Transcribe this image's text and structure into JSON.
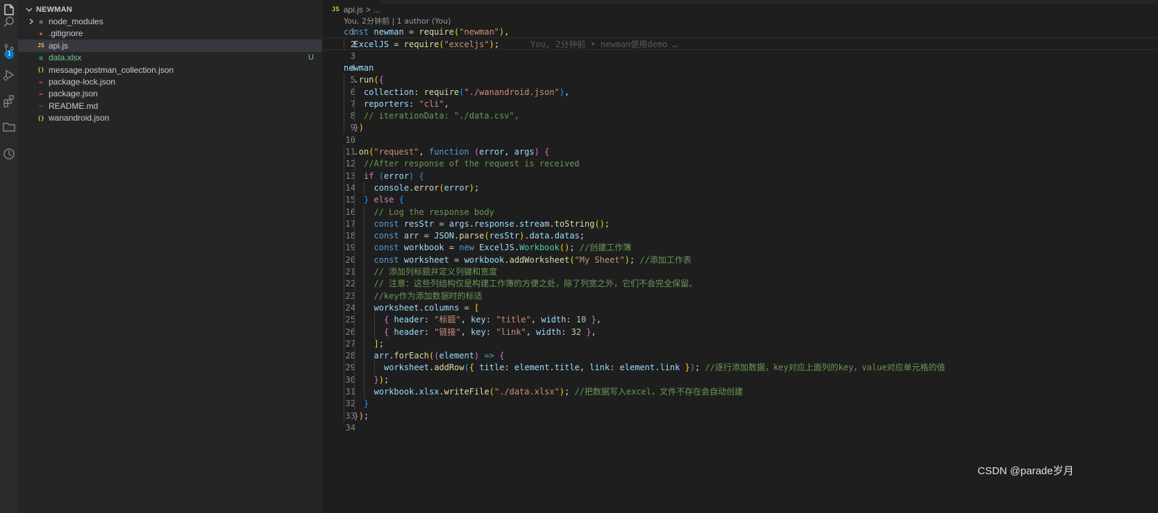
{
  "activity_bar": {
    "icons": [
      "explorer-icon",
      "search-icon",
      "source-control-icon",
      "run-debug-icon",
      "extensions-icon",
      "folder-icon",
      "timeline-icon"
    ],
    "source_control_badge": "1"
  },
  "explorer": {
    "folder_name": "NEWMAN",
    "items": [
      {
        "label": "node_modules",
        "type": "folder",
        "icon": "folder-icon",
        "color": "#6d8086"
      },
      {
        "label": ".gitignore",
        "type": "file",
        "icon": "git-icon",
        "color": "#f14e32"
      },
      {
        "label": "api.js",
        "type": "file",
        "icon": "js-icon",
        "color": "#e8c649",
        "active": true
      },
      {
        "label": "data.xlsx",
        "type": "file",
        "icon": "excel-icon",
        "color": "#1f9e5a",
        "git_status": "U",
        "label_color": "#73c991"
      },
      {
        "label": "message.postman_collection.json",
        "type": "file",
        "icon": "json-braces-icon",
        "color": "#cbcb41"
      },
      {
        "label": "package-lock.json",
        "type": "file",
        "icon": "npm-icon",
        "color": "#cb3837"
      },
      {
        "label": "package.json",
        "type": "file",
        "icon": "npm-icon",
        "color": "#cb3837"
      },
      {
        "label": "README.md",
        "type": "file",
        "icon": "markdown-icon",
        "color": "#6a6a6a"
      },
      {
        "label": "wanandroid.json",
        "type": "file",
        "icon": "json-braces-icon",
        "color": "#cbcb41"
      }
    ]
  },
  "editor": {
    "breadcrumb": {
      "file_icon": "JS",
      "file": "api.js",
      "separator": ">",
      "more": "..."
    },
    "codelens": "You, 2分钟前 | 1 author (You)",
    "blame_ghost": "You, 2分钟前 • newman使用demo …",
    "current_line": 2,
    "lines": [
      {
        "n": "1",
        "indent": 0,
        "tokens": [
          [
            "const ",
            "kw"
          ],
          [
            "newman",
            "var"
          ],
          [
            " = ",
            "pu"
          ],
          [
            "require",
            "fn"
          ],
          [
            "(",
            "b1"
          ],
          [
            "\"newman\"",
            "str"
          ],
          [
            ")",
            "b1"
          ],
          [
            ",",
            "pu"
          ]
        ]
      },
      {
        "n": "2",
        "indent": 1,
        "tokens": [
          [
            "ExcelJS",
            "var"
          ],
          [
            " = ",
            "pu"
          ],
          [
            "require",
            "fn"
          ],
          [
            "(",
            "b1"
          ],
          [
            "\"exceljs\"",
            "str"
          ],
          [
            ")",
            "b1"
          ],
          [
            ";",
            "pu"
          ]
        ]
      },
      {
        "n": "3",
        "indent": 0,
        "tokens": []
      },
      {
        "n": "4",
        "indent": 0,
        "tokens": [
          [
            "newman",
            "var"
          ]
        ]
      },
      {
        "n": "5",
        "indent": 1,
        "tokens": [
          [
            ".",
            "pu"
          ],
          [
            "run",
            "fn"
          ],
          [
            "(",
            "b1"
          ],
          [
            "{",
            "b2"
          ]
        ]
      },
      {
        "n": "6",
        "indent": 2,
        "tokens": [
          [
            "collection",
            "var"
          ],
          [
            ": ",
            "pu"
          ],
          [
            "require",
            "fn"
          ],
          [
            "(",
            "b3"
          ],
          [
            "\"./wanandroid.json\"",
            "str"
          ],
          [
            ")",
            "b3"
          ],
          [
            ",",
            "pu"
          ]
        ]
      },
      {
        "n": "7",
        "indent": 2,
        "tokens": [
          [
            "reporters",
            "var"
          ],
          [
            ": ",
            "pu"
          ],
          [
            "\"cli\"",
            "str"
          ],
          [
            ",",
            "pu"
          ]
        ]
      },
      {
        "n": "8",
        "indent": 2,
        "tokens": [
          [
            "// iterationData: \"./data.csv\",",
            "com"
          ]
        ]
      },
      {
        "n": "9",
        "indent": 1,
        "tokens": [
          [
            "}",
            "b2"
          ],
          [
            ")",
            "b1"
          ]
        ]
      },
      {
        "n": "10",
        "indent": 0,
        "tokens": []
      },
      {
        "n": "11",
        "indent": 1,
        "tokens": [
          [
            ".",
            "pu"
          ],
          [
            "on",
            "fn"
          ],
          [
            "(",
            "b1"
          ],
          [
            "\"request\"",
            "str"
          ],
          [
            ", ",
            "pu"
          ],
          [
            "function ",
            "kw"
          ],
          [
            "(",
            "b2"
          ],
          [
            "error",
            "var"
          ],
          [
            ", ",
            "pu"
          ],
          [
            "args",
            "var"
          ],
          [
            ")",
            "b2"
          ],
          [
            " ",
            "pu"
          ],
          [
            "{",
            "b2"
          ]
        ]
      },
      {
        "n": "12",
        "indent": 2,
        "tokens": [
          [
            "//After response of the request is received",
            "com"
          ]
        ]
      },
      {
        "n": "13",
        "indent": 2,
        "tokens": [
          [
            "if ",
            "kw2"
          ],
          [
            "(",
            "b3"
          ],
          [
            "error",
            "var"
          ],
          [
            ")",
            "b3"
          ],
          [
            " ",
            "pu"
          ],
          [
            "{",
            "b3"
          ]
        ]
      },
      {
        "n": "14",
        "indent": 3,
        "tokens": [
          [
            "console",
            "var"
          ],
          [
            ".",
            "pu"
          ],
          [
            "error",
            "fn"
          ],
          [
            "(",
            "b1"
          ],
          [
            "error",
            "var"
          ],
          [
            ")",
            "b1"
          ],
          [
            ";",
            "pu"
          ]
        ]
      },
      {
        "n": "15",
        "indent": 2,
        "tokens": [
          [
            "}",
            "b3"
          ],
          [
            " else ",
            "kw2"
          ],
          [
            "{",
            "b3"
          ]
        ]
      },
      {
        "n": "16",
        "indent": 3,
        "tokens": [
          [
            "// Log the response body",
            "com"
          ]
        ]
      },
      {
        "n": "17",
        "indent": 3,
        "tokens": [
          [
            "const ",
            "kw"
          ],
          [
            "resStr",
            "var"
          ],
          [
            " = ",
            "pu"
          ],
          [
            "args",
            "var"
          ],
          [
            ".",
            "pu"
          ],
          [
            "response",
            "var"
          ],
          [
            ".",
            "pu"
          ],
          [
            "stream",
            "var"
          ],
          [
            ".",
            "pu"
          ],
          [
            "toString",
            "fn"
          ],
          [
            "()",
            "b1"
          ],
          [
            ";",
            "pu"
          ]
        ]
      },
      {
        "n": "18",
        "indent": 3,
        "tokens": [
          [
            "const ",
            "kw"
          ],
          [
            "arr",
            "var"
          ],
          [
            " = ",
            "pu"
          ],
          [
            "JSON",
            "var"
          ],
          [
            ".",
            "pu"
          ],
          [
            "parse",
            "fn"
          ],
          [
            "(",
            "b1"
          ],
          [
            "resStr",
            "var"
          ],
          [
            ")",
            "b1"
          ],
          [
            ".",
            "pu"
          ],
          [
            "data",
            "var"
          ],
          [
            ".",
            "pu"
          ],
          [
            "datas",
            "var"
          ],
          [
            ";",
            "pu"
          ]
        ]
      },
      {
        "n": "19",
        "indent": 3,
        "tokens": [
          [
            "const ",
            "kw"
          ],
          [
            "workbook",
            "var"
          ],
          [
            " = ",
            "pu"
          ],
          [
            "new ",
            "kw"
          ],
          [
            "ExcelJS",
            "var"
          ],
          [
            ".",
            "pu"
          ],
          [
            "Workbook",
            "cls"
          ],
          [
            "()",
            "b1"
          ],
          [
            "; ",
            "pu"
          ],
          [
            "//创建工作簿",
            "com"
          ]
        ]
      },
      {
        "n": "20",
        "indent": 3,
        "tokens": [
          [
            "const ",
            "kw"
          ],
          [
            "worksheet",
            "var"
          ],
          [
            " = ",
            "pu"
          ],
          [
            "workbook",
            "var"
          ],
          [
            ".",
            "pu"
          ],
          [
            "addWorksheet",
            "fn"
          ],
          [
            "(",
            "b1"
          ],
          [
            "\"My Sheet\"",
            "str"
          ],
          [
            ")",
            "b1"
          ],
          [
            "; ",
            "pu"
          ],
          [
            "//添加工作表",
            "com"
          ]
        ]
      },
      {
        "n": "21",
        "indent": 3,
        "tokens": [
          [
            "// 添加列标题并定义列键和宽度",
            "com"
          ]
        ]
      },
      {
        "n": "22",
        "indent": 3,
        "tokens": [
          [
            "// 注意：这些列结构仅是构建工作簿的方便之处，除了列宽之外，它们不会完全保留。",
            "com"
          ]
        ]
      },
      {
        "n": "23",
        "indent": 3,
        "tokens": [
          [
            "//key作为添加数据时的标适",
            "com"
          ]
        ]
      },
      {
        "n": "24",
        "indent": 3,
        "tokens": [
          [
            "worksheet",
            "var"
          ],
          [
            ".",
            "pu"
          ],
          [
            "columns",
            "var"
          ],
          [
            " = ",
            "pu"
          ],
          [
            "[",
            "b1"
          ]
        ]
      },
      {
        "n": "25",
        "indent": 4,
        "tokens": [
          [
            "{ ",
            "b2"
          ],
          [
            "header",
            "var"
          ],
          [
            ": ",
            "pu"
          ],
          [
            "\"标题\"",
            "str"
          ],
          [
            ", ",
            "pu"
          ],
          [
            "key",
            "var"
          ],
          [
            ": ",
            "pu"
          ],
          [
            "\"title\"",
            "str"
          ],
          [
            ", ",
            "pu"
          ],
          [
            "width",
            "var"
          ],
          [
            ": ",
            "pu"
          ],
          [
            "10",
            "num"
          ],
          [
            " }",
            "b2"
          ],
          [
            ",",
            "pu"
          ]
        ]
      },
      {
        "n": "26",
        "indent": 4,
        "tokens": [
          [
            "{ ",
            "b2"
          ],
          [
            "header",
            "var"
          ],
          [
            ": ",
            "pu"
          ],
          [
            "\"链接\"",
            "str"
          ],
          [
            ", ",
            "pu"
          ],
          [
            "key",
            "var"
          ],
          [
            ": ",
            "pu"
          ],
          [
            "\"link\"",
            "str"
          ],
          [
            ", ",
            "pu"
          ],
          [
            "width",
            "var"
          ],
          [
            ": ",
            "pu"
          ],
          [
            "32",
            "num"
          ],
          [
            " }",
            "b2"
          ],
          [
            ",",
            "pu"
          ]
        ]
      },
      {
        "n": "27",
        "indent": 3,
        "tokens": [
          [
            "]",
            "b1"
          ],
          [
            ";",
            "pu"
          ]
        ]
      },
      {
        "n": "28",
        "indent": 3,
        "tokens": [
          [
            "arr",
            "var"
          ],
          [
            ".",
            "pu"
          ],
          [
            "forEach",
            "fn"
          ],
          [
            "(",
            "b1"
          ],
          [
            "(",
            "b2"
          ],
          [
            "element",
            "var"
          ],
          [
            ")",
            "b2"
          ],
          [
            " => ",
            "kw"
          ],
          [
            "{",
            "b2"
          ]
        ]
      },
      {
        "n": "29",
        "indent": 4,
        "tokens": [
          [
            "worksheet",
            "var"
          ],
          [
            ".",
            "pu"
          ],
          [
            "addRow",
            "fn"
          ],
          [
            "(",
            "b3"
          ],
          [
            "{ ",
            "b1"
          ],
          [
            "title",
            "var"
          ],
          [
            ": ",
            "pu"
          ],
          [
            "element",
            "var"
          ],
          [
            ".",
            "pu"
          ],
          [
            "title",
            "var"
          ],
          [
            ", ",
            "pu"
          ],
          [
            "link",
            "var"
          ],
          [
            ": ",
            "pu"
          ],
          [
            "element",
            "var"
          ],
          [
            ".",
            "pu"
          ],
          [
            "link",
            "var"
          ],
          [
            " }",
            "b1"
          ],
          [
            ")",
            "b3"
          ],
          [
            "; ",
            "pu"
          ],
          [
            "//逐行添加数据，key对应上面列的key，value对应单元格的值",
            "com"
          ]
        ]
      },
      {
        "n": "30",
        "indent": 3,
        "tokens": [
          [
            "}",
            "b2"
          ],
          [
            ")",
            "b1"
          ],
          [
            ";",
            "pu"
          ]
        ]
      },
      {
        "n": "31",
        "indent": 3,
        "tokens": [
          [
            "workbook",
            "var"
          ],
          [
            ".",
            "pu"
          ],
          [
            "xlsx",
            "var"
          ],
          [
            ".",
            "pu"
          ],
          [
            "writeFile",
            "fn"
          ],
          [
            "(",
            "b1"
          ],
          [
            "\"./data.xlsx\"",
            "str"
          ],
          [
            ")",
            "b1"
          ],
          [
            "; ",
            "pu"
          ],
          [
            "//把数据写入excel，文件不存在会自动创建",
            "com"
          ]
        ]
      },
      {
        "n": "32",
        "indent": 2,
        "tokens": [
          [
            "}",
            "b3"
          ]
        ]
      },
      {
        "n": "33",
        "indent": 1,
        "tokens": [
          [
            "}",
            "b2"
          ],
          [
            ")",
            "b1"
          ],
          [
            ";",
            "pu"
          ]
        ]
      },
      {
        "n": "34",
        "indent": 0,
        "tokens": []
      }
    ]
  },
  "watermark": "CSDN @parade岁月"
}
